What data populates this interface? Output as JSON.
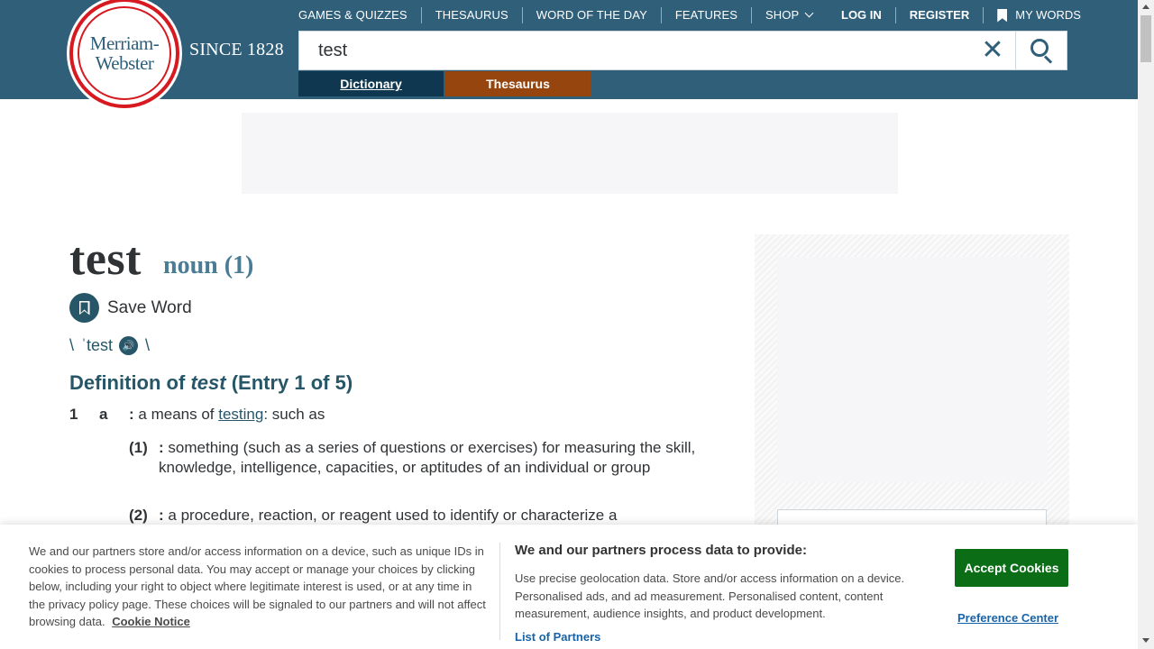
{
  "header": {
    "logo": {
      "line1": "Merriam-",
      "line2": "Webster"
    },
    "since": "SINCE 1828",
    "nav": [
      "GAMES & QUIZZES",
      "THESAURUS",
      "WORD OF THE DAY",
      "FEATURES",
      "SHOP"
    ],
    "login": "LOG IN",
    "register": "REGISTER",
    "my_words": "MY WORDS",
    "search_value": "test",
    "tabs": {
      "dictionary": "Dictionary",
      "thesaurus": "Thesaurus"
    }
  },
  "entry": {
    "headword": "test",
    "part_of_speech": "noun (1)",
    "save_word": "Save Word",
    "pron_open": "\\",
    "pronunciation": "ˈtest",
    "pron_close": "\\",
    "definition_heading": {
      "prefix": "Definition of",
      "word": "test",
      "suffix": "(Entry 1 of 5)"
    },
    "sense_number": "1",
    "sense_letter": "a",
    "sense_a": {
      "colon": ":",
      "before": "a means of",
      "link": "testing",
      "after": ": such as"
    },
    "subsenses": [
      {
        "num": "(1)",
        "colon": ":",
        "text": "something (such as a series of questions or exercises) for measuring the skill, knowledge, intelligence, capacities, or aptitudes of an individual or group"
      },
      {
        "num": "(2)",
        "colon": ":",
        "text": "a procedure, reaction, or reagent used to identify or characterize a"
      }
    ]
  },
  "cookie": {
    "left_text": "We and our partners store and/or access information on a device, such as unique IDs in cookies to process personal data. You may accept or manage your choices by clicking below, including your right to object where legitimate interest is used, or at any time in the privacy policy page. These choices will be signaled to our partners and will not affect browsing data.",
    "cookie_notice": "Cookie Notice",
    "mid_title": "We and our partners process data to provide:",
    "mid_text": "Use precise geolocation data. Store and/or access information on a device. Personalised ads, and ad measurement. Personalised content, content measurement, audience insights, and product development.",
    "list_of_partners": "List of Partners",
    "accept": "Accept Cookies",
    "preference_center": "Preference Center"
  },
  "colors": {
    "header_bg": "#305f7a",
    "dictionary_tab": "#0f3850",
    "thesaurus_tab": "#97450e",
    "accept_button": "#0b6e17",
    "link_blue": "#1863a8"
  },
  "icons": [
    "bookmark-icon",
    "close-icon",
    "search-icon",
    "chevron-down-icon",
    "speaker-icon",
    "save-bookmark-icon"
  ]
}
